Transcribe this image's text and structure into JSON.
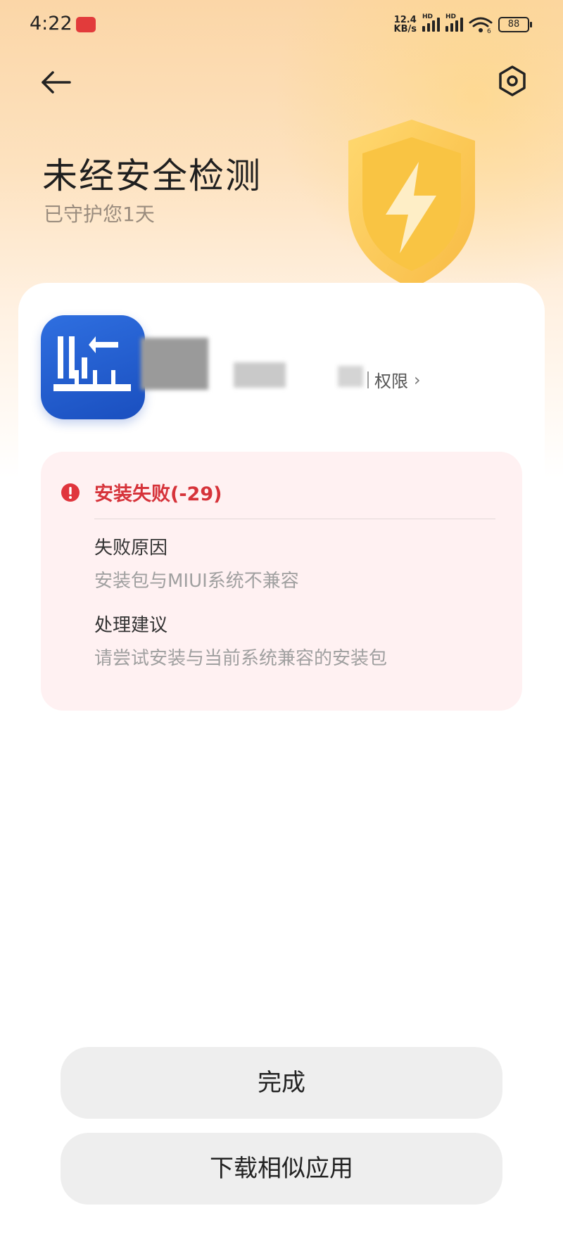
{
  "status_bar": {
    "time": "4:22",
    "net_speed_value": "12.4",
    "net_speed_unit": "KB/s",
    "sim1_label": "HD",
    "sim2_label": "HD",
    "wifi_badge": "6",
    "battery": "88"
  },
  "header": {
    "title": "未经安全检测",
    "subtitle": "已守护您1天"
  },
  "app_card": {
    "permissions_link": "权限"
  },
  "error": {
    "title": "安装失败(-29)",
    "reason_label": "失败原因",
    "reason_text": "安装包与MIUI系统不兼容",
    "advice_label": "处理建议",
    "advice_text": "请尝试安装与当前系统兼容的安装包"
  },
  "buttons": {
    "done": "完成",
    "download_similar": "下载相似应用"
  },
  "colors": {
    "error_red": "#d6333a",
    "error_bg": "#fff1f2",
    "app_icon_blue": "#1a4fbf",
    "header_gradient": "#fbd6a7"
  },
  "icons": {
    "back": "arrow-left-icon",
    "settings": "gear-icon",
    "error": "exclamation-circle-icon",
    "hero": "shield-lightning-icon"
  }
}
